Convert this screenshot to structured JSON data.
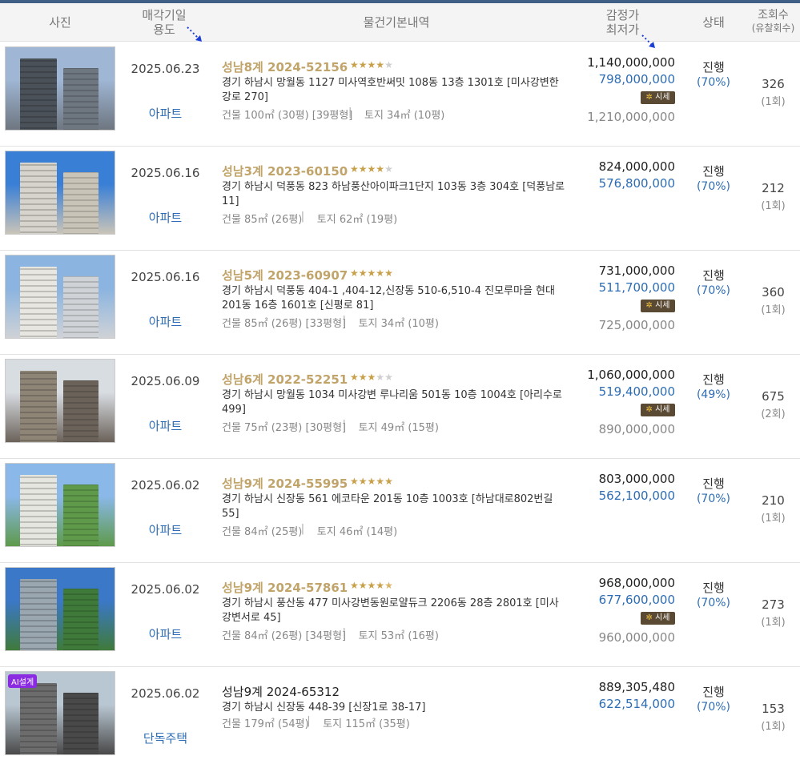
{
  "header": {
    "photo": "사진",
    "date_line1": "매각기일",
    "date_line2": "용도",
    "info": "물건기본내역",
    "price_line1": "감정가",
    "price_line2": "최저가",
    "status": "상태",
    "views_line1": "조회수",
    "views_line2": "(유찰회수)"
  },
  "market_badge": "시세",
  "rows": [
    {
      "date": "2025.06.23",
      "use": "아파트",
      "case": "성남8계 2024-52156",
      "stars": 4,
      "address": "경기 하남시 망월동 1127 미사역호반써밋 108동 13층 1301호 [미사강변한강로 270]",
      "bldg": "건물 100㎡ (30평) [39평형]",
      "land": "토지 34㎡ (10평)",
      "appraised": "1,140,000,000",
      "min": "798,000,000",
      "market": "1,210,000,000",
      "status": "진행",
      "pct": "(70%)",
      "views": "326",
      "fails": "(1회)"
    },
    {
      "date": "2025.06.16",
      "use": "아파트",
      "case": "성남3계 2023-60150",
      "stars": 4,
      "address": "경기 하남시 덕풍동 823 하남풍산아이파크1단지 103동 3층 304호 [덕풍남로 11]",
      "bldg": "건물 85㎡ (26평)",
      "land": "토지 62㎡ (19평)",
      "appraised": "824,000,000",
      "min": "576,800,000",
      "market": "",
      "status": "진행",
      "pct": "(70%)",
      "views": "212",
      "fails": "(1회)"
    },
    {
      "date": "2025.06.16",
      "use": "아파트",
      "case": "성남5계 2023-60907",
      "stars": 5,
      "address": "경기 하남시 덕풍동 404-1 ,404-12,신장동 510-6,510-4 진모루마을 현대 201동 16층 1601호 [신평로 81]",
      "bldg": "건물 85㎡ (26평) [33평형]",
      "land": "토지 34㎡ (10평)",
      "appraised": "731,000,000",
      "min": "511,700,000",
      "market": "725,000,000",
      "status": "진행",
      "pct": "(70%)",
      "views": "360",
      "fails": "(1회)"
    },
    {
      "date": "2025.06.09",
      "use": "아파트",
      "case": "성남6계 2022-52251",
      "stars": 3,
      "address": "경기 하남시 망월동 1034 미사강변 루나리움 501동 10층 1004호 [아리수로 499]",
      "bldg": "건물 75㎡ (23평) [30평형]",
      "land": "토지 49㎡ (15평)",
      "appraised": "1,060,000,000",
      "min": "519,400,000",
      "market": "890,000,000",
      "status": "진행",
      "pct": "(49%)",
      "views": "675",
      "fails": "(2회)"
    },
    {
      "date": "2025.06.02",
      "use": "아파트",
      "case": "성남9계 2024-55995",
      "stars": 5,
      "address": "경기 하남시 신장동 561 에코타운 201동 10층 1003호 [하남대로802번길 55]",
      "bldg": "건물 84㎡ (25평)",
      "land": "토지 46㎡ (14평)",
      "appraised": "803,000,000",
      "min": "562,100,000",
      "market": "",
      "status": "진행",
      "pct": "(70%)",
      "views": "210",
      "fails": "(1회)"
    },
    {
      "date": "2025.06.02",
      "use": "아파트",
      "case": "성남9계 2024-57861",
      "stars": 4.5,
      "address": "경기 하남시 풍산동 477 미사강변동원로얄듀크 2206동 28층 2801호 [미사강변서로 45]",
      "bldg": "건물 84㎡ (26평) [34평형]",
      "land": "토지 53㎡ (16평)",
      "appraised": "968,000,000",
      "min": "677,600,000",
      "market": "960,000,000",
      "status": "진행",
      "pct": "(70%)",
      "views": "273",
      "fails": "(1회)"
    },
    {
      "date": "2025.06.02",
      "use": "단독주택",
      "case": "성남9계 2024-65312",
      "stars": 0,
      "address": "경기 하남시 신장동 448-39 [신장1로 38-17]",
      "bldg": "건물 179㎡ (54평)",
      "land": "토지 115㎡ (35평)",
      "appraised": "889,305,480",
      "min": "622,514,000",
      "market": "",
      "status": "진행",
      "pct": "(70%)",
      "views": "153",
      "fails": "(1회)",
      "ai_badge": "AI설계"
    }
  ]
}
